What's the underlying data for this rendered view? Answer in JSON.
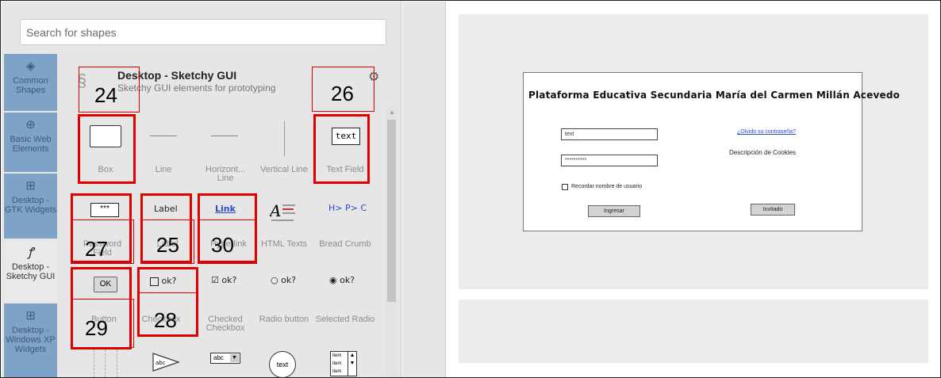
{
  "search": {
    "placeholder": "Search for shapes"
  },
  "sidebar": {
    "items": [
      {
        "label": "Common Shapes",
        "icon": "layers-icon"
      },
      {
        "label": "Basic Web Elements",
        "icon": "globe-icon"
      },
      {
        "label": "Desktop - GTK Widgets",
        "icon": "grid-icon"
      },
      {
        "label": "Desktop - Sketchy GUI",
        "icon": "squiggle-icon"
      },
      {
        "label": "Desktop - Windows XP Widgets",
        "icon": "grid-icon"
      }
    ]
  },
  "library": {
    "title": "Desktop - Sketchy GUI",
    "subtitle": "Sketchy GUI elements for prototyping"
  },
  "shapes": {
    "box": "Box",
    "line": "Line",
    "hline": "Horizont... Line",
    "vline": "Vertical Line",
    "textfield": "Text Field",
    "textfield_icon": "text",
    "password": "Password Field",
    "password_icon": "***",
    "label": "Label",
    "label_icon": "Label",
    "hyperlink": "Hyperlink",
    "link_icon": "Link",
    "htmltexts": "HTML Texts",
    "breadcrumb": "Bread Crumb",
    "breadcrumb_icon": "H> P> C",
    "button": "Button",
    "button_icon": "OK",
    "checkbox": "Checkbox",
    "checkbox_icon": "ok?",
    "checked": "Checked Checkbox",
    "checked_icon": "ok?",
    "radio": "Radio button",
    "radio_icon": "ok?",
    "selected": "Selected Radio",
    "selected_icon": "ok?",
    "combo_icon": "abc",
    "play_icon": "abc",
    "circle_icon": "text",
    "list_icon": "item"
  },
  "annotations": [
    "24",
    "26",
    "27",
    "25",
    "30",
    "29",
    "28"
  ],
  "mockup": {
    "title": "Plataforma Educativa Secundaria María del Carmen Millán Acevedo",
    "user_value": "text",
    "pass_value": "**********",
    "forgot_link": "¿Olvido su contraseña?",
    "cookies": "Descripción de Cookies",
    "remember": "Recordar nombre de usuario",
    "login_btn": "Ingresar",
    "guest_btn": "Invitado"
  },
  "colors": {
    "sidebar_active": "#7fa3c6",
    "highlight": "#e00000",
    "link": "#2c49c8"
  }
}
